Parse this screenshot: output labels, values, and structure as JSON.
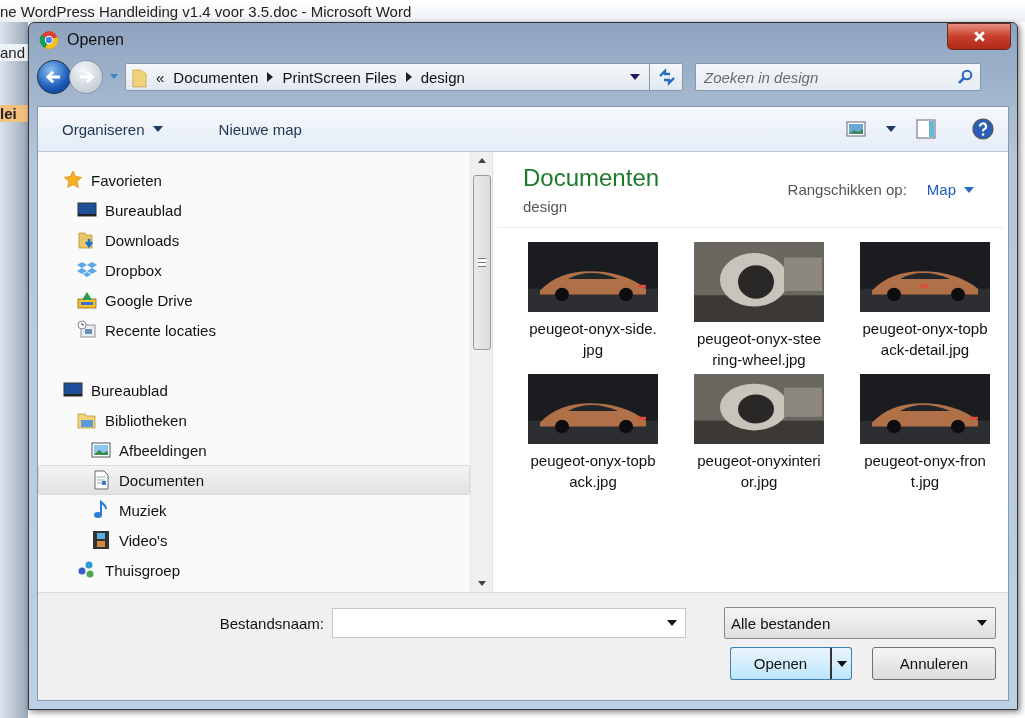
{
  "background_window": {
    "title": "ne WordPress Handleiding v1.4 voor 3.5.doc - Microsoft Word",
    "fragments": [
      "and",
      "lei"
    ]
  },
  "window": {
    "title": "Openen"
  },
  "address": {
    "overflow": "«",
    "crumbs": [
      "Documenten",
      "PrintScreen Files",
      "design"
    ]
  },
  "search": {
    "placeholder": "Zoeken in design"
  },
  "toolbar": {
    "organize": "Organiseren",
    "new_folder": "Nieuwe map"
  },
  "nav": {
    "groups": [
      {
        "label": "Favorieten",
        "kind": "star",
        "selected": false,
        "children": [
          {
            "label": "Bureaublad",
            "kind": "desktop",
            "selected": false
          },
          {
            "label": "Downloads",
            "kind": "downloads",
            "selected": false
          },
          {
            "label": "Dropbox",
            "kind": "dropbox",
            "selected": false
          },
          {
            "label": "Google Drive",
            "kind": "drive",
            "selected": false
          },
          {
            "label": "Recente locaties",
            "kind": "recent",
            "selected": false
          }
        ]
      },
      {
        "label": "Bureaublad",
        "kind": "desktop",
        "selected": false,
        "children": [
          {
            "label": "Bibliotheken",
            "kind": "library",
            "selected": false,
            "children": [
              {
                "label": "Afbeeldingen",
                "kind": "pictures",
                "selected": false
              },
              {
                "label": "Documenten",
                "kind": "document",
                "selected": true
              },
              {
                "label": "Muziek",
                "kind": "music",
                "selected": false
              },
              {
                "label": "Video's",
                "kind": "video",
                "selected": false
              }
            ]
          },
          {
            "label": "Thuisgroep",
            "kind": "homegroup",
            "selected": false
          }
        ]
      }
    ]
  },
  "content": {
    "title": "Documenten",
    "subtitle": "design",
    "arrange_label": "Rangschikken op:",
    "arrange_value": "Map",
    "files": [
      {
        "name": "peugeot-onyx-side.jpg",
        "kind": "picture"
      },
      {
        "name": "peugeot-onyx-steering-wheel.jpg",
        "kind": "picture"
      },
      {
        "name": "peugeot-onyx-topback-detail.jpg",
        "kind": "picture"
      },
      {
        "name": "peugeot-onyx-topback.jpg",
        "kind": "picture"
      },
      {
        "name": "peugeot-onyxinterior.jpg",
        "kind": "picture"
      },
      {
        "name": "peugeot-onyx-front.jpg",
        "kind": "picture"
      }
    ]
  },
  "footer": {
    "filename_label": "Bestandsnaam:",
    "filter": "Alle bestanden",
    "open": "Openen",
    "cancel": "Annuleren"
  }
}
